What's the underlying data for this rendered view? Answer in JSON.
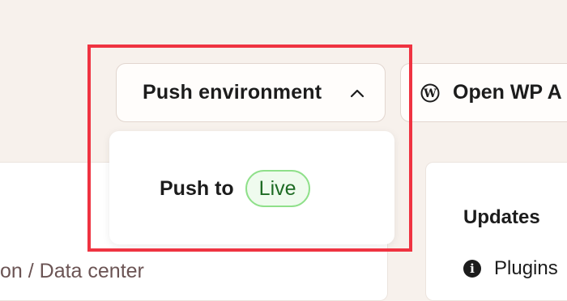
{
  "header": {
    "push_button_label": "Push environment",
    "wp_button_label": "Open WP A"
  },
  "dropdown": {
    "items": [
      {
        "label": "Push to",
        "badge": "Live"
      }
    ]
  },
  "left_card": {
    "text": "on / Data center"
  },
  "updates": {
    "title": "Updates",
    "items": [
      {
        "icon": "info-icon",
        "label": "Plugins"
      }
    ]
  },
  "colors": {
    "highlight": "#ef3341",
    "live_badge_border": "#8fe08a",
    "live_badge_text": "#1e6b24",
    "background": "#f7f1ec"
  }
}
